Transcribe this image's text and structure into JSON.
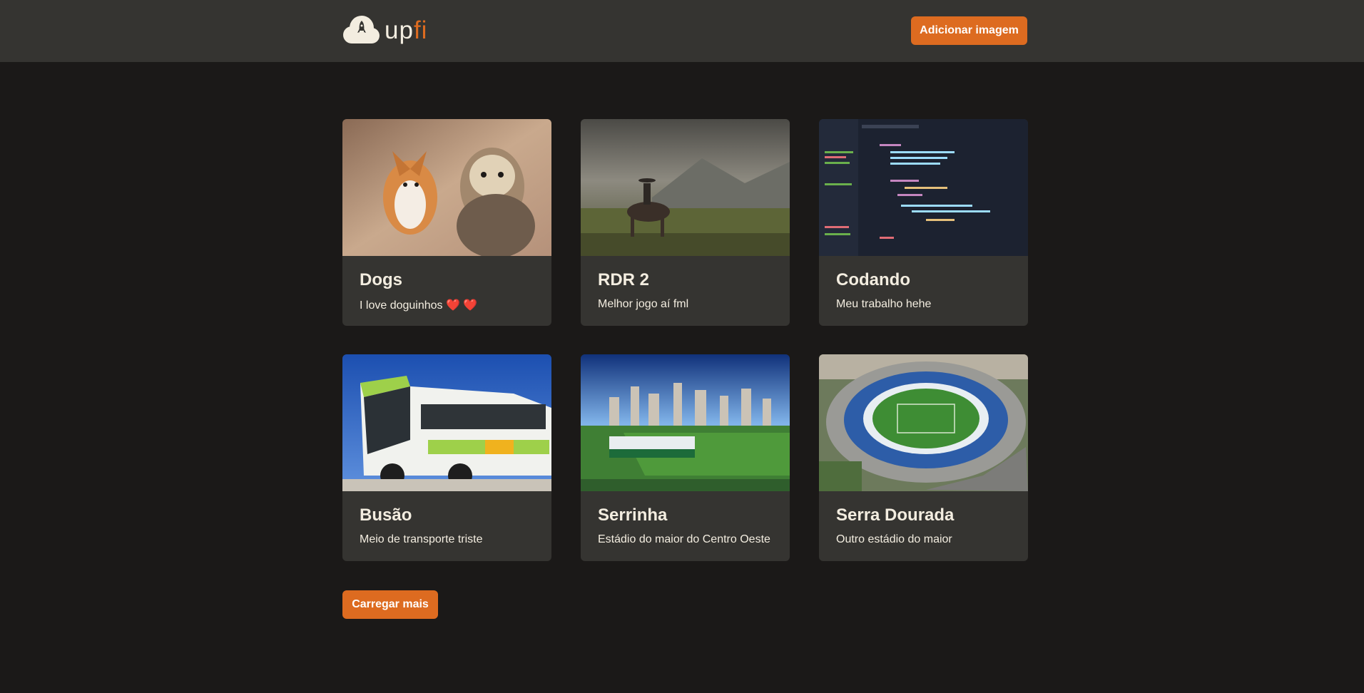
{
  "header": {
    "logo_text_main": "up",
    "logo_text_accent": "fi",
    "logo_icon": "cloud-rocket-icon",
    "add_button_label": "Adicionar imagem"
  },
  "cards": [
    {
      "title": "Dogs",
      "description": "I love doguinhos ❤️ ❤️",
      "image": "dogs-photo"
    },
    {
      "title": "RDR 2",
      "description": "Melhor jogo aí fml",
      "image": "cowboy-horse-photo"
    },
    {
      "title": "Codando",
      "description": "Meu trabalho hehe",
      "image": "code-editor-photo"
    },
    {
      "title": "Busão",
      "description": "Meio de transporte triste",
      "image": "bus-photo"
    },
    {
      "title": "Serrinha",
      "description": "Estádio do maior do Centro Oeste",
      "image": "stadium-city-photo"
    },
    {
      "title": "Serra Dourada",
      "description": "Outro estádio do maior",
      "image": "stadium-aerial-photo"
    }
  ],
  "load_more_label": "Carregar mais",
  "colors": {
    "accent": "#dd6b20",
    "background": "#1b1918",
    "surface": "#353431",
    "text": "#f3ede0"
  }
}
